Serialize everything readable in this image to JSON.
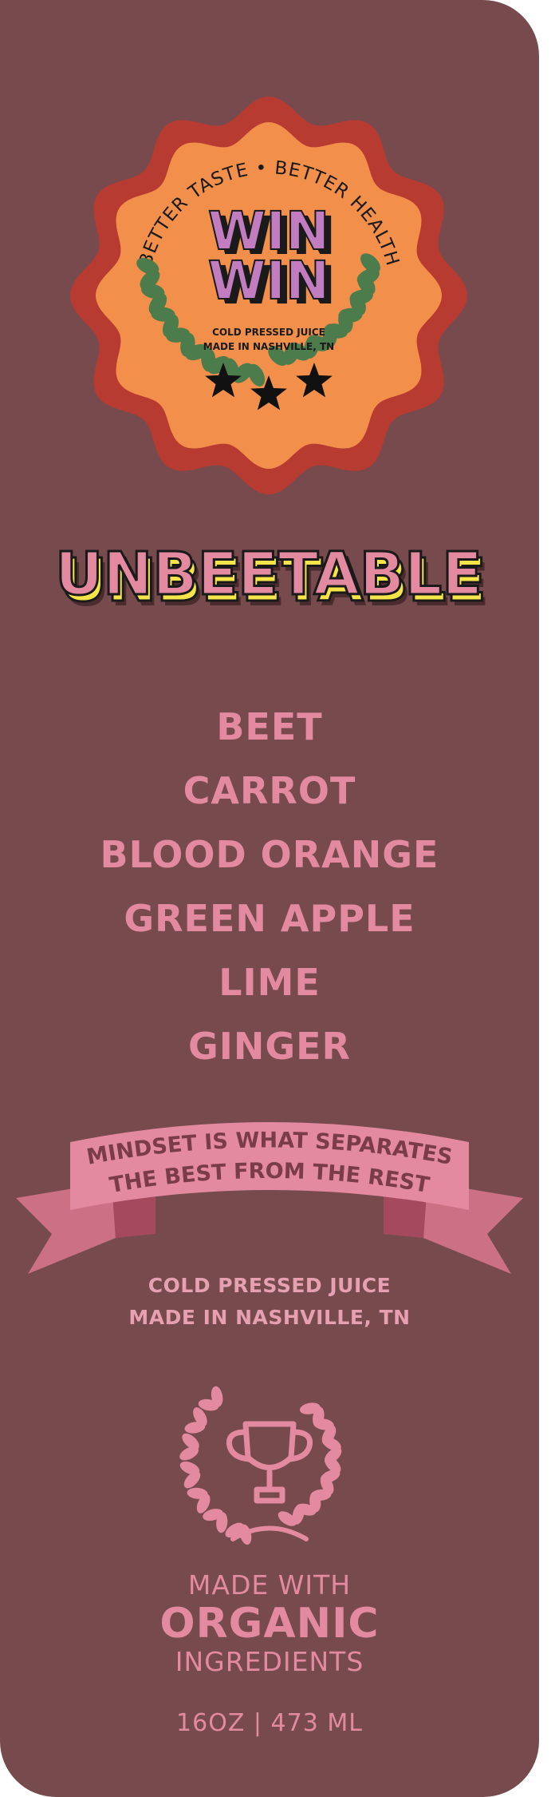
{
  "seal": {
    "arc_text": "BETTER TASTE • BETTER HEALTH",
    "brand_line1": "WIN",
    "brand_line2": "WIN",
    "sub_line1": "COLD PRESSED JUICE",
    "sub_line2": "MADE IN NASHVILLE, TN"
  },
  "product": {
    "name": "UNBEETABLE"
  },
  "ingredients": [
    "BEET",
    "CARROT",
    "BLOOD ORANGE",
    "GREEN APPLE",
    "LIME",
    "GINGER"
  ],
  "banner": {
    "line1": "MINDSET IS WHAT SEPARATES",
    "line2": "THE BEST FROM THE REST"
  },
  "made_in": {
    "line1": "COLD PRESSED JUICE",
    "line2": "MADE IN NASHVILLE, TN"
  },
  "organic": {
    "line1": "MADE WITH",
    "line2": "ORGANIC",
    "line3": "INGREDIENTS"
  },
  "size": "16OZ | 473 ML",
  "colors": {
    "background": "#774a4d",
    "pink": "#e38aa0",
    "seal_red": "#b83b32",
    "seal_orange": "#f2904b",
    "purple": "#c27cc0",
    "leaf_green": "#4c7b4c",
    "yellow": "#f5e54a"
  }
}
